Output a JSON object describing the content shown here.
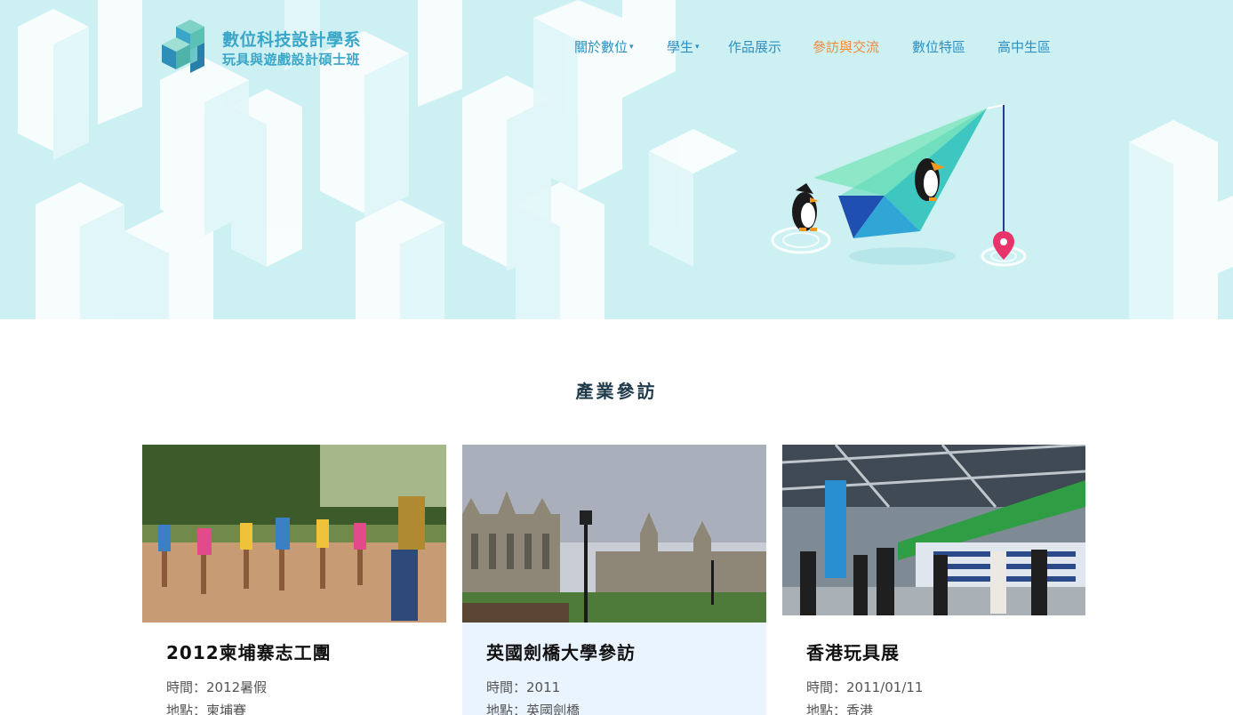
{
  "header": {
    "logo": {
      "line1": "數位科技設計學系",
      "line2": "玩具與遊戲設計碩士班"
    },
    "nav": [
      {
        "label": "關於數位",
        "caret": "▾"
      },
      {
        "label": "學生",
        "caret": "▾"
      },
      {
        "label": "作品展示"
      },
      {
        "label": "參訪與交流",
        "active": true
      },
      {
        "label": "數位特區"
      },
      {
        "label": "高中生區"
      }
    ],
    "colors": {
      "hero_bg": "#cdf0f2",
      "nav": "#2f8fc0",
      "nav_active": "#ef8b3c",
      "brand": "#3aa6c8"
    }
  },
  "hero_illustration": {
    "icons": [
      "paper-plane-icon",
      "penguin-icon",
      "map-pin-icon"
    ]
  },
  "section": {
    "title": "產業參訪"
  },
  "cards": [
    {
      "title": "2012柬埔寨志工團",
      "time": "時間：2012暑假",
      "place": "地點：柬埔賽",
      "photo": "children-dancing-photo"
    },
    {
      "title": "英國劍橋大學參訪",
      "time": "時間：2011",
      "place": "地點：英國劍橋",
      "photo": "cambridge-college-photo"
    },
    {
      "title": "香港玩具展",
      "time": "時間：2011/01/11",
      "place": "地點：香港",
      "photo": "toy-fair-booth-photo"
    }
  ]
}
